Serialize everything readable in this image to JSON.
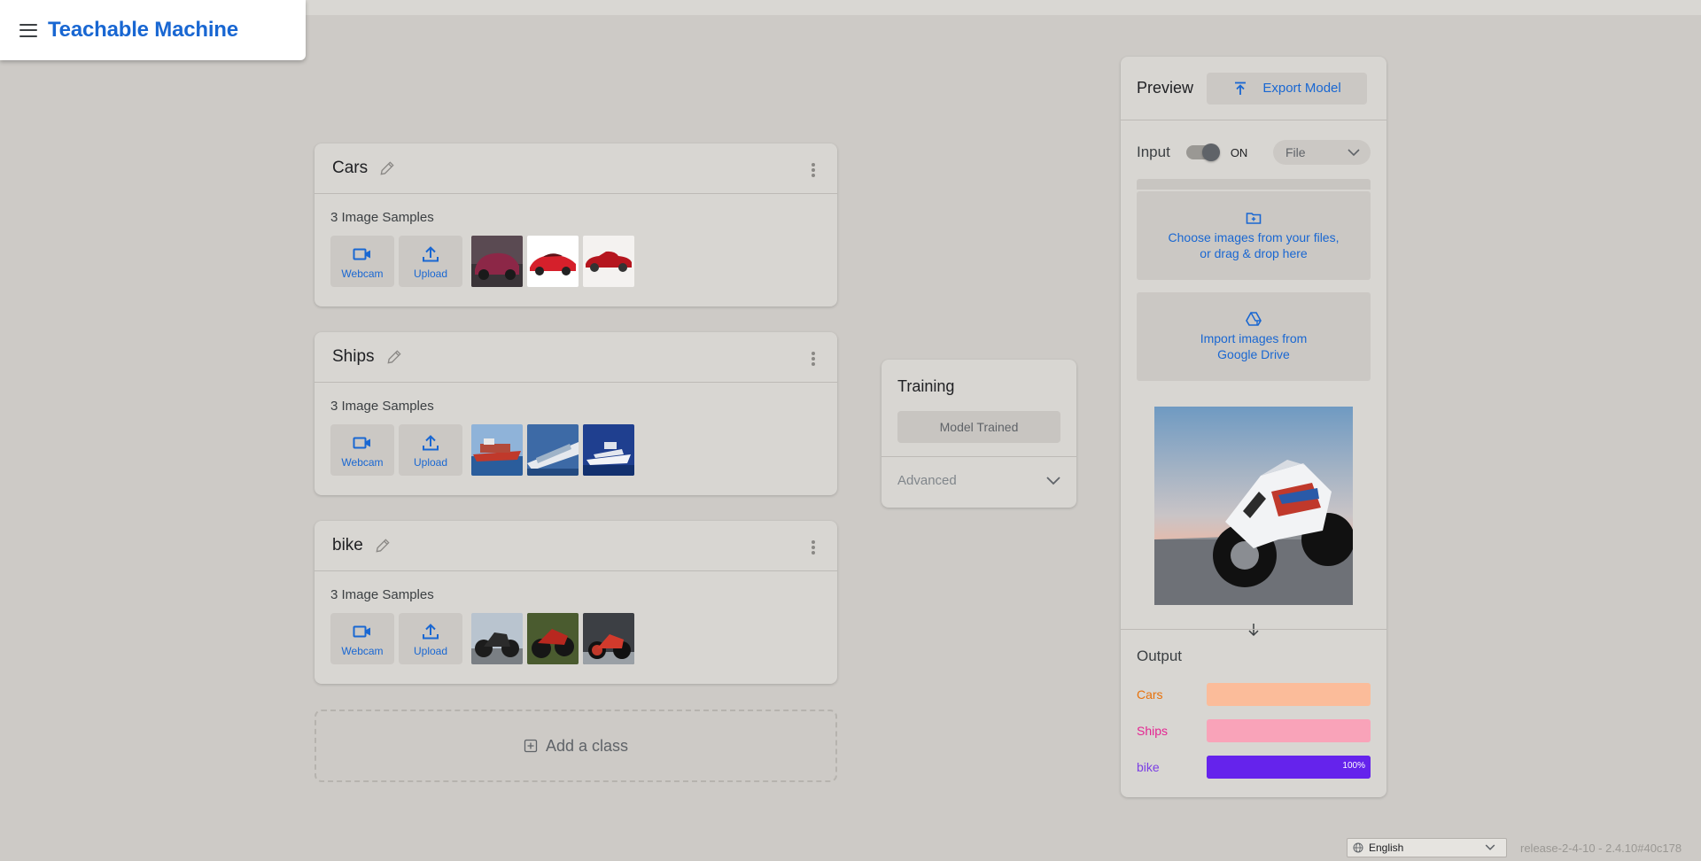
{
  "app": {
    "title": "Teachable Machine"
  },
  "classes": [
    {
      "name": "Cars",
      "samples_label": "3 Image Samples",
      "webcam_label": "Webcam",
      "upload_label": "Upload"
    },
    {
      "name": "Ships",
      "samples_label": "3 Image Samples",
      "webcam_label": "Webcam",
      "upload_label": "Upload"
    },
    {
      "name": "bike",
      "samples_label": "3 Image Samples",
      "webcam_label": "Webcam",
      "upload_label": "Upload"
    }
  ],
  "add_class": {
    "label": "Add a class"
  },
  "training": {
    "title": "Training",
    "button_label": "Model Trained",
    "advanced_label": "Advanced"
  },
  "preview": {
    "title": "Preview",
    "export_label": "Export Model",
    "input_label": "Input",
    "toggle_state": "ON",
    "source_select": "File",
    "drop_text_line1": "Choose images from your files,",
    "drop_text_line2": "or drag & drop here",
    "drive_text_line1": "Import images from",
    "drive_text_line2": "Google Drive"
  },
  "output": {
    "title": "Output",
    "items": [
      {
        "label": "Cars",
        "value": 0,
        "color": "#e8710a",
        "bar_color": "#fbbc9a"
      },
      {
        "label": "Ships",
        "value": 0,
        "color": "#e52592",
        "bar_color": "#f9a3b9"
      },
      {
        "label": "bike",
        "value": 1,
        "value_label": "100%",
        "color": "#7b3fe4",
        "bar_color": "#6523ec"
      }
    ]
  },
  "footer": {
    "language": "English",
    "release": "release-2-4-10 - 2.4.10#40c178"
  },
  "colors": {
    "accent": "#1967d2",
    "background": "#cdcac6",
    "card": "#d8d6d2"
  },
  "icons": {
    "menu": "hamburger-icon",
    "edit": "pencil-icon",
    "more": "more-vert-icon",
    "webcam": "videocam-icon",
    "upload": "upload-icon",
    "export": "export-icon",
    "folder": "folder-add-icon",
    "drive": "google-drive-icon",
    "add": "add-box-icon",
    "globe": "globe-icon"
  }
}
